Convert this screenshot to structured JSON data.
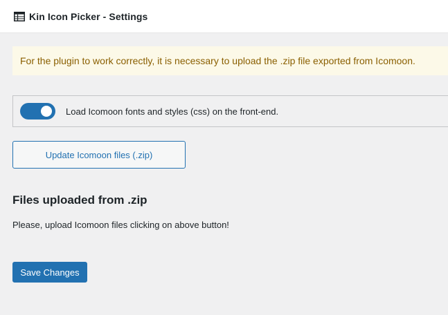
{
  "header": {
    "icon": "table-grid-icon",
    "title": "Kin Icon Picker - Settings"
  },
  "notice": {
    "text": "For the plugin to work correctly, it is necessary to upload the .zip file exported from Icomoon.",
    "background_color": "#fcf9e8",
    "text_color": "#8a5f00"
  },
  "option": {
    "toggle_on": true,
    "toggle_color": "#2271b1",
    "label": "Load Icomoon fonts and styles (css) on the front-end."
  },
  "actions": {
    "update_label": "Update Icomoon files (.zip)",
    "save_label": "Save Changes"
  },
  "files_section": {
    "title": "Files uploaded from .zip",
    "message": "Please, upload Icomoon files clicking on above button!"
  },
  "colors": {
    "accent": "#2271b1",
    "background": "#f0f0f1"
  }
}
